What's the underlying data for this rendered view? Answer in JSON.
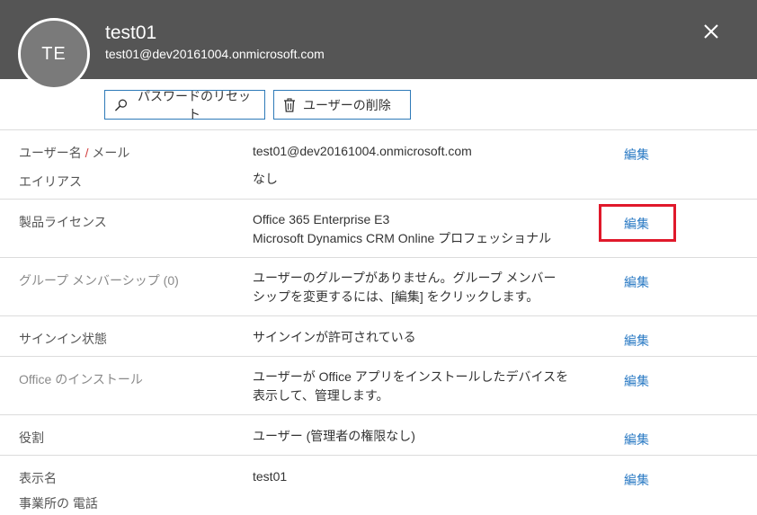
{
  "header": {
    "avatar_initials": "TE",
    "name": "test01",
    "email": "test01@dev20161004.onmicrosoft.com",
    "close_icon": "close-icon"
  },
  "actions": {
    "reset_password": "パスワードのリセット",
    "delete_user": "ユーザーの削除"
  },
  "rows": {
    "username": {
      "label_part1": "ユーザー名",
      "label_sep": " / ",
      "label_part2": "メール",
      "value": "test01@dev20161004.onmicrosoft.com",
      "edit": "編集"
    },
    "alias": {
      "label": "エイリアス",
      "value": "なし"
    },
    "license": {
      "label": "製品ライセンス",
      "value_line1": "Office 365 Enterprise E3",
      "value_line2": "Microsoft Dynamics CRM Online プロフェッショナル",
      "edit": "編集"
    },
    "groups": {
      "label": "グループ メンバーシップ",
      "count": "(0)",
      "value_line1": "ユーザーのグループがありません。グループ メンバー",
      "value_line2": "シップを変更するには、[編集] をクリックします。",
      "edit": "編集"
    },
    "signin": {
      "label": "サインイン状態",
      "value": "サインインが許可されている",
      "edit": "編集"
    },
    "office_install": {
      "label": "Office のインストール",
      "value_line1": "ユーザーが Office アプリをインストールしたデバイスを",
      "value_line2": "表示して、管理します。",
      "edit": "編集"
    },
    "role": {
      "label": "役割",
      "value": "ユーザー (管理者の権限なし)",
      "edit": "編集"
    },
    "display_name": {
      "label": "表示名",
      "label2": "事業所の 電話",
      "value": "test01",
      "edit": "編集"
    }
  }
}
